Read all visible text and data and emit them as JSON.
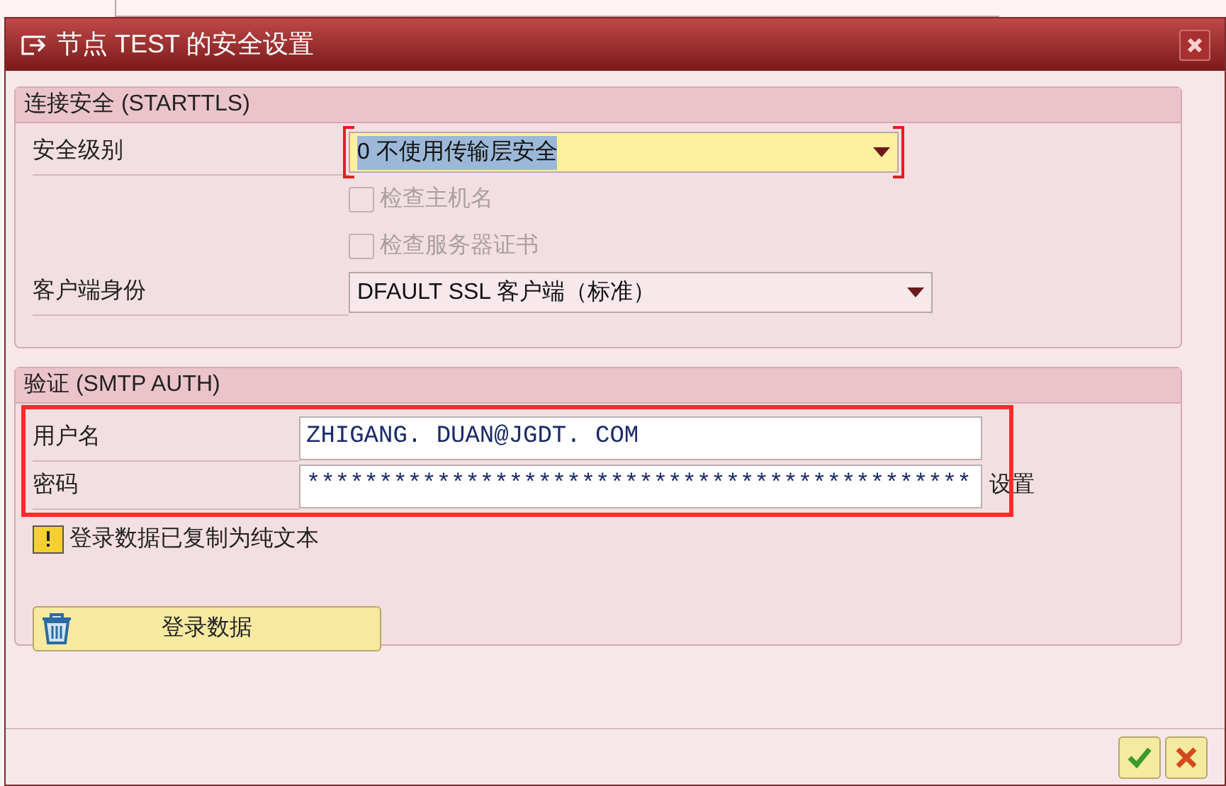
{
  "window": {
    "title": "节点 TEST 的安全设置"
  },
  "connection": {
    "title": "连接安全 (STARTTLS)",
    "rows": [
      {
        "kind": "select",
        "label": "安全级别",
        "value": "0 不使用传输层安全",
        "focused": true
      },
      {
        "kind": "checkbox",
        "label": "检查主机名",
        "checked": false,
        "disabled": true
      },
      {
        "kind": "checkbox",
        "label": "检查服务器证书",
        "checked": false,
        "disabled": true
      },
      {
        "kind": "select",
        "label": "客户端身份",
        "value": "DFAULT SSL 客户端（标准）",
        "focused": false
      }
    ]
  },
  "auth": {
    "title": "验证 (SMTP AUTH)",
    "fields": [
      {
        "label": "用户名",
        "value": "ZHIGANG. DUAN@JGDT. COM"
      },
      {
        "label": "密码",
        "value": "**********************************************",
        "suffix": "设置"
      }
    ],
    "message": "登录数据已复制为纯文本",
    "button": "登录数据"
  },
  "footer_buttons": [
    {
      "kind": "confirm"
    },
    {
      "kind": "cancel"
    }
  ]
}
